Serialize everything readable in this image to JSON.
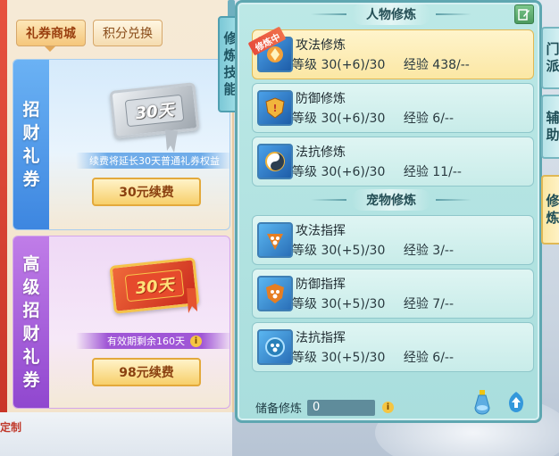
{
  "left_panel": {
    "tabs": [
      {
        "label": "礼券商城"
      },
      {
        "label": "积分兑换"
      }
    ],
    "cards": [
      {
        "side_label": "招财礼券",
        "ticket_text": "30天",
        "description": "续费将延长30天普通礼券权益",
        "button_label": "30元续费"
      },
      {
        "side_label": "高级招财礼券",
        "ticket_text": "30天",
        "description": "有效期剩余160天",
        "info_icon": "i",
        "button_label": "98元续费"
      }
    ],
    "bottom_red_text": "定制"
  },
  "vertical_tab": {
    "label": "修炼技能"
  },
  "cultivation": {
    "person_section_title": "人物修炼",
    "pet_section_title": "宠物修炼",
    "level_label": "等级",
    "exp_label": "经验",
    "person_rows": [
      {
        "name": "攻法修炼",
        "level": "30(+6)/30",
        "exp": "438/--",
        "badge": "修炼中",
        "icon": "attack-magic-icon"
      },
      {
        "name": "防御修炼",
        "level": "30(+6)/30",
        "exp": "6/--",
        "icon": "defense-shield-icon"
      },
      {
        "name": "法抗修炼",
        "level": "30(+6)/30",
        "exp": "11/--",
        "icon": "yin-yang-icon"
      }
    ],
    "pet_rows": [
      {
        "name": "攻法指挥",
        "level": "30(+5)/30",
        "exp": "3/--",
        "icon": "paw-attack-icon"
      },
      {
        "name": "防御指挥",
        "level": "30(+5)/30",
        "exp": "7/--",
        "icon": "paw-defense-icon"
      },
      {
        "name": "法抗指挥",
        "level": "30(+5)/30",
        "exp": "6/--",
        "icon": "paw-resist-icon"
      }
    ],
    "storage_label": "储备修炼",
    "storage_value": "0",
    "storage_info": "i"
  },
  "right_tabs": [
    {
      "label": "门派"
    },
    {
      "label": "辅助"
    },
    {
      "label": "修炼"
    }
  ],
  "colors": {
    "panel_bg": "#bce8e6",
    "active_row": "#fbe7a4",
    "card_blue": "#3d86e0",
    "card_purple": "#9047cf",
    "button_gold": "#f7cf6a"
  }
}
